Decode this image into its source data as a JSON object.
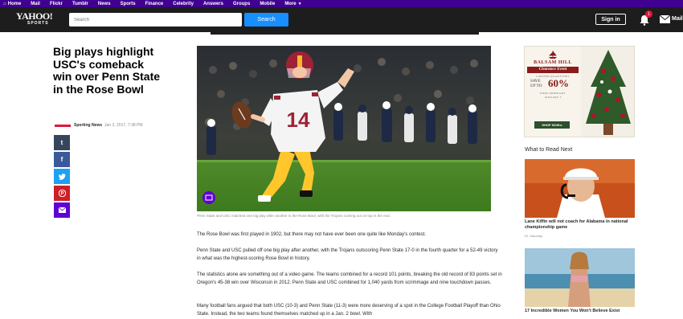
{
  "topnav": {
    "items": [
      "Home",
      "Mail",
      "Flickr",
      "Tumblr",
      "News",
      "Sports",
      "Finance",
      "Celebrity",
      "Answers",
      "Groups",
      "Mobile",
      "More"
    ]
  },
  "header": {
    "logo_main": "YAHOO!",
    "logo_sub": "SPORTS",
    "search_placeholder": "Search",
    "search_button": "Search",
    "signin": "Sign in",
    "notification_count": "1",
    "mail_label": "Mail"
  },
  "article": {
    "headline": "Big plays highlight USC's comeback win over Penn State in the Rose Bowl",
    "author": "Sporting News",
    "date": "Jan 3, 2017, 7:38 PM",
    "caption": "Penn State and USC matched one big play after another in the Rose Bowl, with the Trojans coming out on top in the end.",
    "paragraphs": [
      "The Rose Bowl was first played in 1902, but there may not have ever been one quite like Monday's contest.",
      "Penn State and USC pulled off one big play after another, with the Trojans outscoring Penn State 17-0 in the fourth quarter for a 52-49 victory in what was the highest-scoring Rose Bowl in history.",
      "The statistics alone are something out of a video game. The teams combined for a record 101 points, breaking the old record of 83 points set in Oregon's 45-38 win over Wisconsin in 2012. Penn State and USC combined for 1,040 yards from scrimmage and nine touchdown passes.",
      "Many football fans argued that both USC (10-3) and Penn State (11-3) were more deserving of a spot in the College Football Playoff than Ohio State. Instead, the two teams found themselves matched up in a Jan. 2 bowl. With"
    ],
    "jersey_number": "14"
  },
  "share": {
    "tumblr": "t",
    "facebook": "f",
    "twitter": "t",
    "pinterest": "P",
    "email": "✉"
  },
  "ad": {
    "brand": "BALSAM HILL",
    "event": "Clearance Event",
    "limited": "LIMITED QUANTITIES",
    "save_line1": "SAVE",
    "save_line2": "UP TO",
    "percent": "60%",
    "ends": "ENDS MIDNIGHT",
    "date": "JANUARY 3",
    "shop": "SHOP NOW ▸"
  },
  "rail": {
    "heading": "What to Read Next",
    "stories": [
      {
        "title": "Lane Kiffin will not coach for Alabama in national championship game",
        "source": "Dr. Saturday"
      },
      {
        "title": "17 Incredible Women You Won't Believe Exist",
        "source": ""
      }
    ]
  },
  "colors": {
    "topbar": "#400090",
    "header": "#1d1d1d",
    "search_button": "#188fff",
    "usc_cardinal": "#9d2235",
    "usc_gold": "#ffc72c"
  }
}
